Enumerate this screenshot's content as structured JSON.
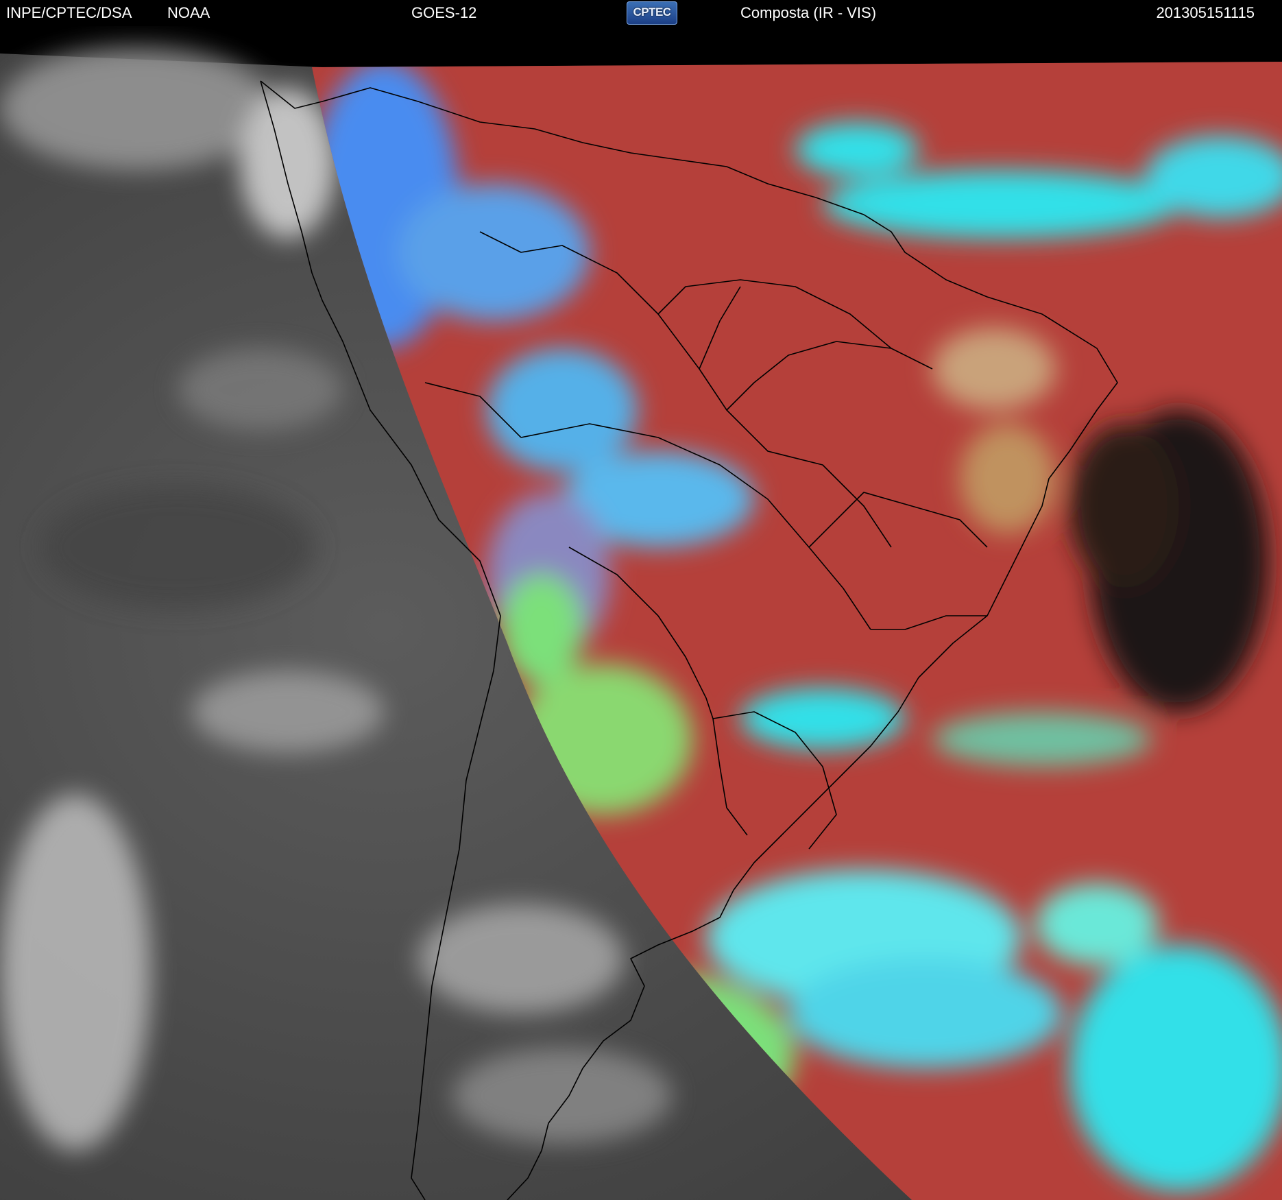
{
  "header": {
    "org": "INPE/CPTEC/DSA",
    "partner": "NOAA",
    "satellite": "GOES-12",
    "logo_text": "CPTEC",
    "product": "Composta (IR - VIS)",
    "timestamp": "201305151115"
  },
  "colors": {
    "night_ir": "#5a5a5a",
    "day_land": "#b5403a",
    "day_cloud_cyan": "#33e0e8",
    "day_cloud_blue": "#4a8cf0",
    "day_cloud_green": "#7ce07a",
    "clear_ocean": "#1a1414"
  }
}
